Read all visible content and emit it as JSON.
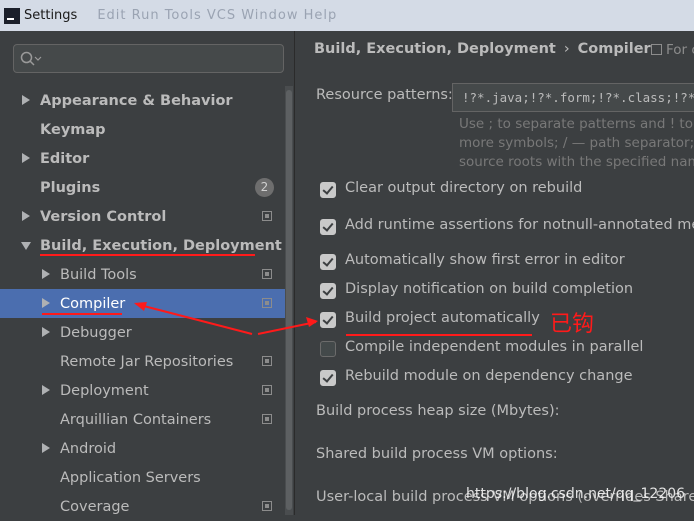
{
  "window": {
    "title": "Settings",
    "ghost_menu": "Edit  Run  Tools  VCS  Window  Help"
  },
  "search": {
    "placeholder": ""
  },
  "sidebar": {
    "items": [
      {
        "label": "Appearance & Behavior",
        "bold": true,
        "arrow": "right",
        "level": 0
      },
      {
        "label": "Keymap",
        "bold": true,
        "arrow": "none",
        "level": 0
      },
      {
        "label": "Editor",
        "bold": true,
        "arrow": "right",
        "level": 0
      },
      {
        "label": "Plugins",
        "bold": true,
        "arrow": "none",
        "level": 0,
        "badge": "2"
      },
      {
        "label": "Version Control",
        "bold": true,
        "arrow": "right",
        "level": 0,
        "copy_icon": true
      },
      {
        "label": "Build, Execution, Deployment",
        "bold": true,
        "arrow": "down",
        "level": 0
      },
      {
        "label": "Build Tools",
        "bold": false,
        "arrow": "right",
        "level": 1,
        "copy_icon": true
      },
      {
        "label": "Compiler",
        "bold": false,
        "arrow": "right",
        "level": 1,
        "copy_icon": true,
        "selected": true
      },
      {
        "label": "Debugger",
        "bold": false,
        "arrow": "right",
        "level": 1
      },
      {
        "label": "Remote Jar Repositories",
        "bold": false,
        "arrow": "none",
        "level": 1,
        "copy_icon": true
      },
      {
        "label": "Deployment",
        "bold": false,
        "arrow": "right",
        "level": 1,
        "copy_icon": true
      },
      {
        "label": "Arquillian Containers",
        "bold": false,
        "arrow": "none",
        "level": 1,
        "copy_icon": true
      },
      {
        "label": "Android",
        "bold": false,
        "arrow": "right",
        "level": 1
      },
      {
        "label": "Application Servers",
        "bold": false,
        "arrow": "none",
        "level": 1
      },
      {
        "label": "Coverage",
        "bold": false,
        "arrow": "none",
        "level": 1,
        "copy_icon": true
      }
    ]
  },
  "header": {
    "breadcrumb_parent": "Build, Execution, Deployment",
    "breadcrumb_sep": "›",
    "breadcrumb_current": "Compiler",
    "for_current": "For c"
  },
  "compiler": {
    "resource_label": "Resource patterns:",
    "resource_value": "!?*.java;!?*.form;!?*.class;!?*.",
    "hint_lines": [
      "Use ; to separate patterns and ! to n",
      "more symbols; / — path separator; /",
      "source roots with the specified nam"
    ],
    "options": [
      {
        "label": "Clear output directory on rebuild",
        "checked": true
      },
      {
        "label": "Add runtime assertions for notnull-annotated metho",
        "checked": true
      },
      {
        "label": "Automatically show first error in editor",
        "checked": true
      },
      {
        "label": "Display notification on build completion",
        "checked": true
      },
      {
        "label": "Build project automatically",
        "checked": true
      },
      {
        "label": "Compile independent modules in parallel",
        "checked": false
      },
      {
        "label": "Rebuild module on dependency change",
        "checked": true
      }
    ],
    "heap_label": "Build process heap size (Mbytes):",
    "shared_vm_label": "Shared build process VM options:",
    "user_vm_label": "User-local build process VM options (overrides Share"
  },
  "annotation": {
    "text": "已钩",
    "color": "#ff1a1a"
  },
  "watermark": "https://blog.csdn.net/qq_12206",
  "colors": {
    "selection": "#4b6eaf",
    "background": "#3c3f41",
    "annotation": "#ff1a1a"
  }
}
